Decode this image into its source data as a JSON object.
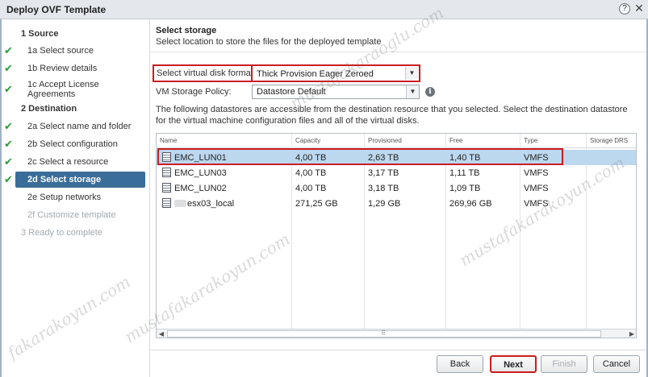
{
  "window": {
    "title": "Deploy OVF Template",
    "help_icon": "?",
    "close_icon": "✕"
  },
  "sidebar": {
    "steps": [
      {
        "label": "1  Source",
        "done": false
      },
      {
        "label": "1a  Select source",
        "done": true
      },
      {
        "label": "1b  Review details",
        "done": true
      },
      {
        "label": "1c  Accept License Agreements",
        "done": true
      },
      {
        "label": "2  Destination",
        "done": false
      },
      {
        "label": "2a  Select name and folder",
        "done": true
      },
      {
        "label": "2b  Select configuration",
        "done": true
      },
      {
        "label": "2c  Select a resource",
        "done": true
      },
      {
        "label": "2d  Select storage",
        "done": true,
        "active": true
      },
      {
        "label": "2e  Setup networks",
        "done": false
      },
      {
        "label": "2f  Customize template",
        "done": false,
        "disabled": true
      },
      {
        "label": "3  Ready to complete",
        "done": false,
        "disabled": true
      }
    ]
  },
  "main": {
    "title": "Select storage",
    "subtitle": "Select location to store the files for the deployed template",
    "disk_format_label": "Select virtual disk format:",
    "disk_format_value": "Thick Provision Eager Zeroed",
    "policy_label": "VM Storage Policy:",
    "policy_value": "Datastore Default",
    "description": "The following datastores are accessible from the destination resource that you selected. Select the destination datastore for the virtual machine configuration files and all of the virtual disks.",
    "table": {
      "columns": [
        "Name",
        "Capacity",
        "Provisioned",
        "Free",
        "Type",
        "Storage DRS"
      ],
      "rows": [
        {
          "name": "EMC_LUN01",
          "capacity": "4,00 TB",
          "provisioned": "2,63 TB",
          "free": "1,40 TB",
          "type": "VMFS",
          "selected": true
        },
        {
          "name": "EMC_LUN03",
          "capacity": "4,00 TB",
          "provisioned": "3,17 TB",
          "free": "1,11 TB",
          "type": "VMFS"
        },
        {
          "name": "EMC_LUN02",
          "capacity": "4,00 TB",
          "provisioned": "3,18 TB",
          "free": "1,09 TB",
          "type": "VMFS"
        },
        {
          "name": "esx03_local",
          "capacity": "271,25 GB",
          "provisioned": "1,29 GB",
          "free": "269,96 GB",
          "type": "VMFS"
        }
      ]
    }
  },
  "footer": {
    "back": "Back",
    "next": "Next",
    "finish": "Finish",
    "cancel": "Cancel"
  },
  "watermark": [
    "mustafakaraoglu.com",
    "fakarakoyun.com",
    "mustafakarakoyun.com",
    "mustafakarakoyun.com"
  ],
  "colors": {
    "accent": "#3a6d99",
    "selected_row": "#bcd8ef",
    "highlight": "#cc1c1c",
    "check": "#2e9a3c"
  }
}
